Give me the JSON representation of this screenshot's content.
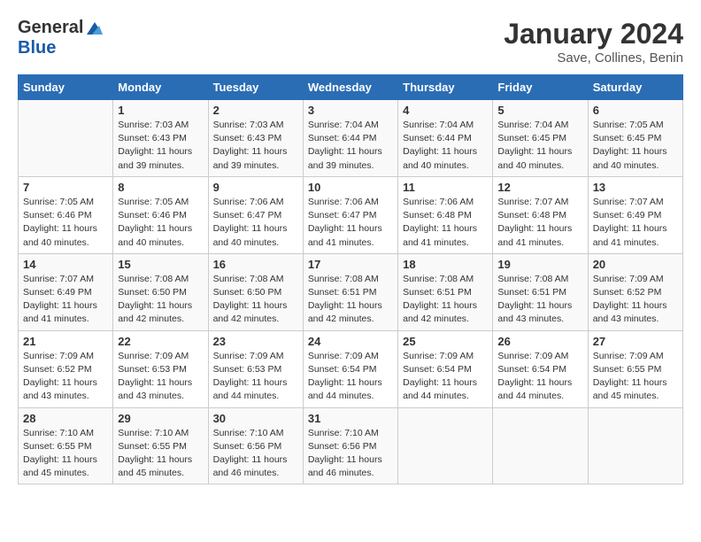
{
  "header": {
    "logo_line1": "General",
    "logo_line2": "Blue",
    "title": "January 2024",
    "subtitle": "Save, Collines, Benin"
  },
  "days_of_week": [
    "Sunday",
    "Monday",
    "Tuesday",
    "Wednesday",
    "Thursday",
    "Friday",
    "Saturday"
  ],
  "weeks": [
    [
      {
        "day": "",
        "sunrise": "",
        "sunset": "",
        "daylight": ""
      },
      {
        "day": "1",
        "sunrise": "Sunrise: 7:03 AM",
        "sunset": "Sunset: 6:43 PM",
        "daylight": "Daylight: 11 hours and 39 minutes."
      },
      {
        "day": "2",
        "sunrise": "Sunrise: 7:03 AM",
        "sunset": "Sunset: 6:43 PM",
        "daylight": "Daylight: 11 hours and 39 minutes."
      },
      {
        "day": "3",
        "sunrise": "Sunrise: 7:04 AM",
        "sunset": "Sunset: 6:44 PM",
        "daylight": "Daylight: 11 hours and 39 minutes."
      },
      {
        "day": "4",
        "sunrise": "Sunrise: 7:04 AM",
        "sunset": "Sunset: 6:44 PM",
        "daylight": "Daylight: 11 hours and 40 minutes."
      },
      {
        "day": "5",
        "sunrise": "Sunrise: 7:04 AM",
        "sunset": "Sunset: 6:45 PM",
        "daylight": "Daylight: 11 hours and 40 minutes."
      },
      {
        "day": "6",
        "sunrise": "Sunrise: 7:05 AM",
        "sunset": "Sunset: 6:45 PM",
        "daylight": "Daylight: 11 hours and 40 minutes."
      }
    ],
    [
      {
        "day": "7",
        "sunrise": "Sunrise: 7:05 AM",
        "sunset": "Sunset: 6:46 PM",
        "daylight": "Daylight: 11 hours and 40 minutes."
      },
      {
        "day": "8",
        "sunrise": "Sunrise: 7:05 AM",
        "sunset": "Sunset: 6:46 PM",
        "daylight": "Daylight: 11 hours and 40 minutes."
      },
      {
        "day": "9",
        "sunrise": "Sunrise: 7:06 AM",
        "sunset": "Sunset: 6:47 PM",
        "daylight": "Daylight: 11 hours and 40 minutes."
      },
      {
        "day": "10",
        "sunrise": "Sunrise: 7:06 AM",
        "sunset": "Sunset: 6:47 PM",
        "daylight": "Daylight: 11 hours and 41 minutes."
      },
      {
        "day": "11",
        "sunrise": "Sunrise: 7:06 AM",
        "sunset": "Sunset: 6:48 PM",
        "daylight": "Daylight: 11 hours and 41 minutes."
      },
      {
        "day": "12",
        "sunrise": "Sunrise: 7:07 AM",
        "sunset": "Sunset: 6:48 PM",
        "daylight": "Daylight: 11 hours and 41 minutes."
      },
      {
        "day": "13",
        "sunrise": "Sunrise: 7:07 AM",
        "sunset": "Sunset: 6:49 PM",
        "daylight": "Daylight: 11 hours and 41 minutes."
      }
    ],
    [
      {
        "day": "14",
        "sunrise": "Sunrise: 7:07 AM",
        "sunset": "Sunset: 6:49 PM",
        "daylight": "Daylight: 11 hours and 41 minutes."
      },
      {
        "day": "15",
        "sunrise": "Sunrise: 7:08 AM",
        "sunset": "Sunset: 6:50 PM",
        "daylight": "Daylight: 11 hours and 42 minutes."
      },
      {
        "day": "16",
        "sunrise": "Sunrise: 7:08 AM",
        "sunset": "Sunset: 6:50 PM",
        "daylight": "Daylight: 11 hours and 42 minutes."
      },
      {
        "day": "17",
        "sunrise": "Sunrise: 7:08 AM",
        "sunset": "Sunset: 6:51 PM",
        "daylight": "Daylight: 11 hours and 42 minutes."
      },
      {
        "day": "18",
        "sunrise": "Sunrise: 7:08 AM",
        "sunset": "Sunset: 6:51 PM",
        "daylight": "Daylight: 11 hours and 42 minutes."
      },
      {
        "day": "19",
        "sunrise": "Sunrise: 7:08 AM",
        "sunset": "Sunset: 6:51 PM",
        "daylight": "Daylight: 11 hours and 43 minutes."
      },
      {
        "day": "20",
        "sunrise": "Sunrise: 7:09 AM",
        "sunset": "Sunset: 6:52 PM",
        "daylight": "Daylight: 11 hours and 43 minutes."
      }
    ],
    [
      {
        "day": "21",
        "sunrise": "Sunrise: 7:09 AM",
        "sunset": "Sunset: 6:52 PM",
        "daylight": "Daylight: 11 hours and 43 minutes."
      },
      {
        "day": "22",
        "sunrise": "Sunrise: 7:09 AM",
        "sunset": "Sunset: 6:53 PM",
        "daylight": "Daylight: 11 hours and 43 minutes."
      },
      {
        "day": "23",
        "sunrise": "Sunrise: 7:09 AM",
        "sunset": "Sunset: 6:53 PM",
        "daylight": "Daylight: 11 hours and 44 minutes."
      },
      {
        "day": "24",
        "sunrise": "Sunrise: 7:09 AM",
        "sunset": "Sunset: 6:54 PM",
        "daylight": "Daylight: 11 hours and 44 minutes."
      },
      {
        "day": "25",
        "sunrise": "Sunrise: 7:09 AM",
        "sunset": "Sunset: 6:54 PM",
        "daylight": "Daylight: 11 hours and 44 minutes."
      },
      {
        "day": "26",
        "sunrise": "Sunrise: 7:09 AM",
        "sunset": "Sunset: 6:54 PM",
        "daylight": "Daylight: 11 hours and 44 minutes."
      },
      {
        "day": "27",
        "sunrise": "Sunrise: 7:09 AM",
        "sunset": "Sunset: 6:55 PM",
        "daylight": "Daylight: 11 hours and 45 minutes."
      }
    ],
    [
      {
        "day": "28",
        "sunrise": "Sunrise: 7:10 AM",
        "sunset": "Sunset: 6:55 PM",
        "daylight": "Daylight: 11 hours and 45 minutes."
      },
      {
        "day": "29",
        "sunrise": "Sunrise: 7:10 AM",
        "sunset": "Sunset: 6:55 PM",
        "daylight": "Daylight: 11 hours and 45 minutes."
      },
      {
        "day": "30",
        "sunrise": "Sunrise: 7:10 AM",
        "sunset": "Sunset: 6:56 PM",
        "daylight": "Daylight: 11 hours and 46 minutes."
      },
      {
        "day": "31",
        "sunrise": "Sunrise: 7:10 AM",
        "sunset": "Sunset: 6:56 PM",
        "daylight": "Daylight: 11 hours and 46 minutes."
      },
      {
        "day": "",
        "sunrise": "",
        "sunset": "",
        "daylight": ""
      },
      {
        "day": "",
        "sunrise": "",
        "sunset": "",
        "daylight": ""
      },
      {
        "day": "",
        "sunrise": "",
        "sunset": "",
        "daylight": ""
      }
    ]
  ]
}
